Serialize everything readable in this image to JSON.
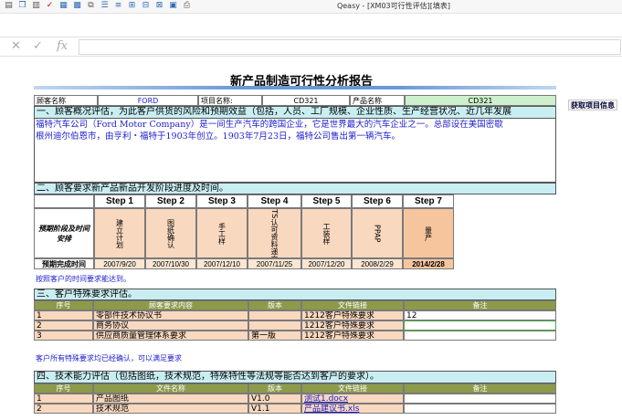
{
  "window": {
    "app_title": "Qeasy - [XM03可行性评估][填表]"
  },
  "report": {
    "title": "新产品制造可行性分析报告",
    "fetch_button": "获取项目信息",
    "header_row": {
      "customer_label": "顾客名称",
      "customer_value": "FORD",
      "project_label": "项目名称:",
      "project_value": "CD321",
      "product_label": "产品名称",
      "product_value": "CD321"
    },
    "section1": {
      "title": "一、顾客概况评估，为此客户供货的风险和预期效益（包括，人员、工厂规模、企业性质、生产经营状况、近几年发展",
      "line1": "福特汽车公司（Ford Motor Company）是一间生产汽车的跨国企业，它是世界最大的汽车企业之一。总部设在美国密歇",
      "line2": "根州迪尔伯恩市，由亨利・福特于1903年创立。1903年7月23日，福特公司售出第一辆汽车。"
    },
    "section2": {
      "title": "二、顾客要求新产品新品开发阶段进度及时间。",
      "row_label": "预期阶段及时间安排",
      "done_label": "预期完成时间",
      "steps": [
        {
          "head": "Step 1",
          "name": "建立计划",
          "date": "2007/9/20"
        },
        {
          "head": "Step 2",
          "name": "图纸确认",
          "date": "2007/10/30"
        },
        {
          "head": "Step 3",
          "name": "手工样",
          "date": "2007/12/10"
        },
        {
          "head": "Step 4",
          "name": "OTS认可资料递交",
          "date": "2007/11/25"
        },
        {
          "head": "Step 5",
          "name": "工装样",
          "date": "2007/12/20"
        },
        {
          "head": "Step 6",
          "name": "PPAP",
          "date": "2008/2/29"
        },
        {
          "head": "Step 7",
          "name": "量产",
          "date": "2014/2/28"
        }
      ],
      "note": "按照客户的时间要求能达到。"
    },
    "section3": {
      "title": "三、客户特殊要求评估。",
      "columns": [
        "序号",
        "顾客要求内容",
        "版本",
        "文件链接",
        "备注"
      ],
      "rows": [
        {
          "no": "1",
          "content": "零部件技术协议书",
          "version": "",
          "link": "1212客户特殊要求",
          "remark": "12"
        },
        {
          "no": "2",
          "content": "商务协议",
          "version": "",
          "link": "1212客户特殊要求",
          "remark": ""
        },
        {
          "no": "3",
          "content": "供应商质量管理体系要求",
          "version": "第一版",
          "link": "1212客户特殊要求",
          "remark": ""
        }
      ],
      "note": "客户所有特殊要求均已经确认，可以满足要求"
    },
    "section4": {
      "title": "四、技术能力评估（包括图纸，技术规范，特殊特性等法规等能否达到客户的要求）。",
      "columns": [
        "序号",
        "文件名称",
        "版本",
        "文件链接",
        "备注"
      ],
      "rows": [
        {
          "no": "1",
          "content": "产品图纸",
          "version": "V1.0",
          "link": "测试1.docx",
          "remark": ""
        },
        {
          "no": "2",
          "content": "技术规范",
          "version": "V1.1",
          "link": "产品建议书.xls",
          "remark": ""
        }
      ]
    }
  },
  "colors": {
    "section_bg": "#c9eef2",
    "header_blue": "#6a9ad6",
    "table_head_green": "#8c9a4a",
    "row_peach": "#f8d8bf",
    "step_bg": "#f8d8bf",
    "product_green": "#ccf0cc"
  }
}
